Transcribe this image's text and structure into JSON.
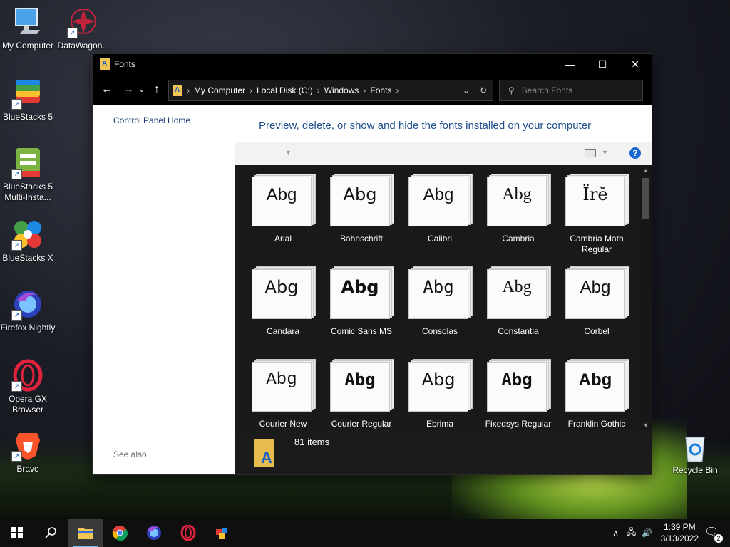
{
  "desktop": {
    "icons": [
      {
        "label": "My Computer"
      },
      {
        "label": "DataWagon..."
      },
      {
        "label": "BlueStacks 5"
      },
      {
        "label": "BlueStacks 5 Multi-Insta..."
      },
      {
        "label": "BlueStacks X"
      },
      {
        "label": "Firefox Nightly"
      },
      {
        "label": "Opera GX Browser"
      },
      {
        "label": "Brave"
      },
      {
        "label": "Recycle Bin"
      }
    ]
  },
  "window": {
    "title": "Fonts",
    "path": [
      "My Computer",
      "Local Disk (C:)",
      "Windows",
      "Fonts"
    ],
    "search_placeholder": "Search Fonts",
    "sidebar": {
      "home_link": "Control Panel Home",
      "see_also": "See also"
    },
    "heading": "Preview, delete, or show and hide the fonts installed on your computer",
    "fonts": [
      {
        "name": "Arial",
        "sample": "Abg"
      },
      {
        "name": "Bahnschrift",
        "sample": "Abg"
      },
      {
        "name": "Calibri",
        "sample": "Abg"
      },
      {
        "name": "Cambria",
        "sample": "Abg"
      },
      {
        "name": "Cambria Math Regular",
        "sample": "Ïrĕ"
      },
      {
        "name": "Candara",
        "sample": "Abg"
      },
      {
        "name": "Comic Sans MS",
        "sample": "Abg"
      },
      {
        "name": "Consolas",
        "sample": "Abg"
      },
      {
        "name": "Constantia",
        "sample": "Abg"
      },
      {
        "name": "Corbel",
        "sample": "Abg"
      },
      {
        "name": "Courier New",
        "sample": "Abg"
      },
      {
        "name": "Courier Regular",
        "sample": "Abg"
      },
      {
        "name": "Ebrima",
        "sample": "Abg"
      },
      {
        "name": "Fixedsys Regular",
        "sample": "Abg"
      },
      {
        "name": "Franklin Gothic",
        "sample": "Abg"
      }
    ],
    "status": {
      "item_count": "81 items"
    }
  },
  "taskbar": {
    "apps": [
      "start-icon",
      "search-icon",
      "file-explorer-icon",
      "chrome-icon",
      "firefox-icon",
      "opera-icon",
      "bluestacks-icon"
    ],
    "clock": {
      "time": "1:39 PM",
      "date": "3/13/2022"
    },
    "notification_count": "2"
  },
  "colors": {
    "accent": "#1967d2",
    "link": "#1e4e8c",
    "folder": "#f1c654"
  }
}
